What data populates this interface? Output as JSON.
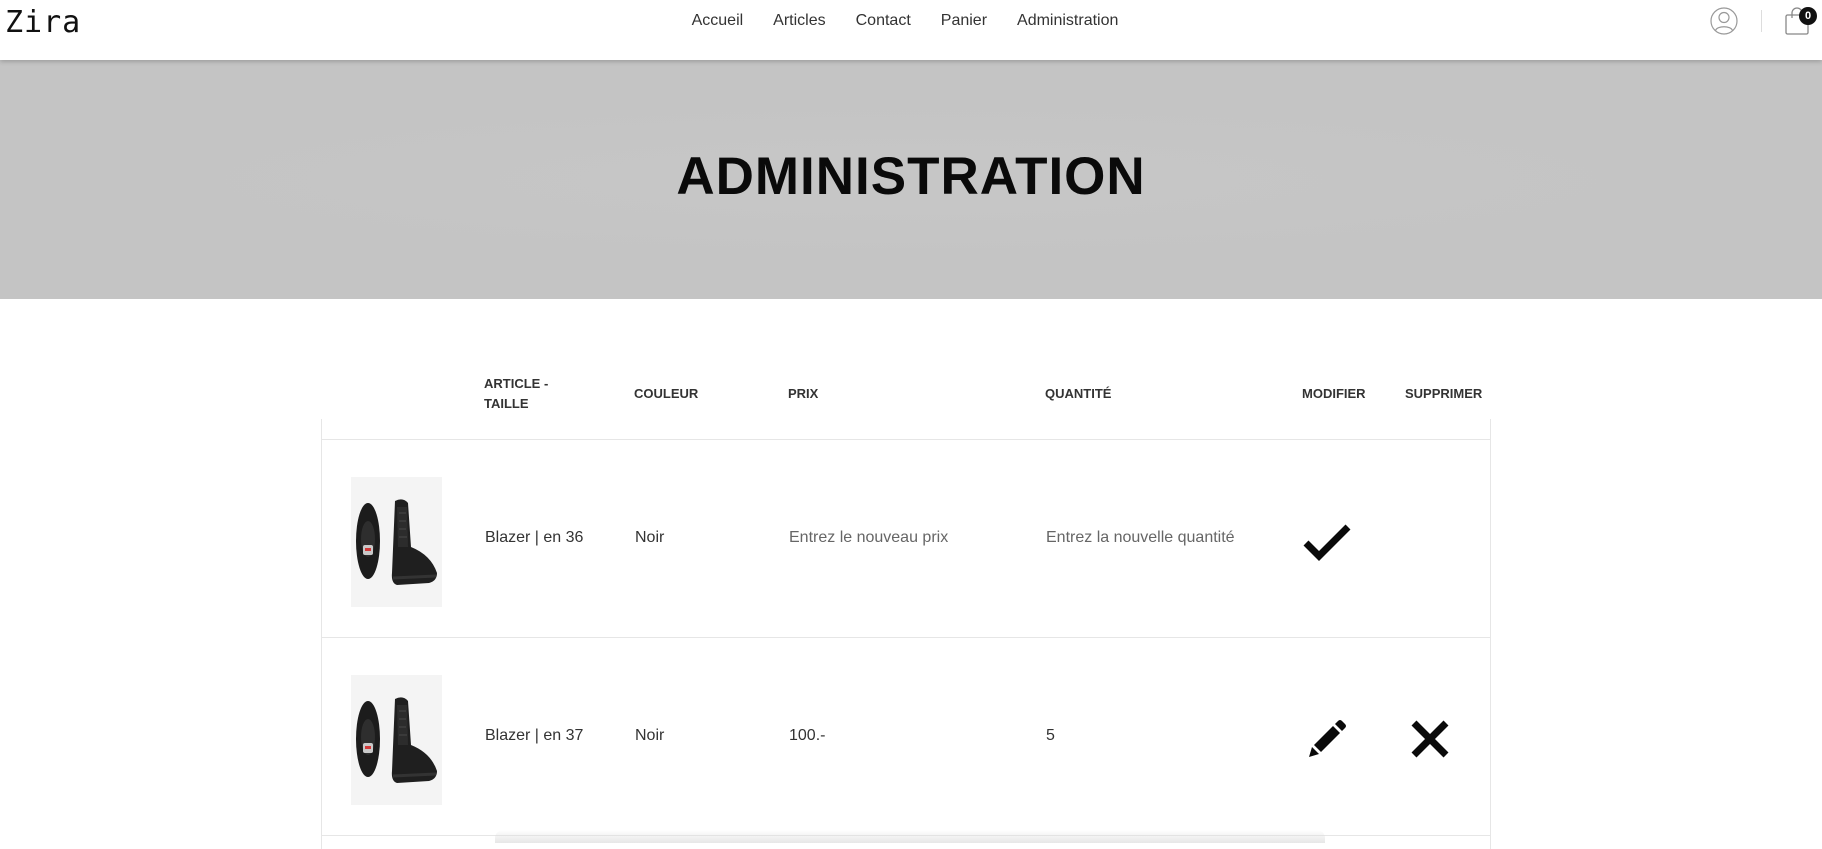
{
  "header": {
    "logo": "Zira",
    "nav": [
      {
        "label": "Accueil"
      },
      {
        "label": "Articles"
      },
      {
        "label": "Contact"
      },
      {
        "label": "Panier"
      },
      {
        "label": "Administration"
      }
    ],
    "user_icon": "user-circle-icon",
    "cart_icon": "shopping-bag-icon",
    "cart_count": "0"
  },
  "hero": {
    "title": "ADMINISTRATION"
  },
  "table": {
    "headers": {
      "image": "",
      "article": "ARTICLE - TAILLE",
      "article_line1": "ARTICLE -",
      "article_line2": "TAILLE",
      "color": "COULEUR",
      "price": "PRIX",
      "quantity": "QUANTITÉ",
      "edit": "MODIFIER",
      "delete": "SUPPRIMER"
    },
    "rows": [
      {
        "image_icon": "sneaker-image",
        "article": "Blazer | en 36",
        "color": "Noir",
        "price": "",
        "price_placeholder": "Entrez le nouveau prix",
        "quantity": "",
        "quantity_placeholder": "Entrez la nouvelle quantité",
        "edit_icon": "check-icon",
        "delete_icon": ""
      },
      {
        "image_icon": "sneaker-image",
        "article": "Blazer | en 37",
        "color": "Noir",
        "price": "100.-",
        "price_placeholder": "",
        "quantity": "5",
        "quantity_placeholder": "",
        "edit_icon": "pencil-icon",
        "delete_icon": "close-icon"
      }
    ]
  },
  "colors": {
    "hero_bg": "#c4c4c4",
    "text": "#333333",
    "title": "#0a0a0a",
    "border": "#e6e6e6"
  }
}
